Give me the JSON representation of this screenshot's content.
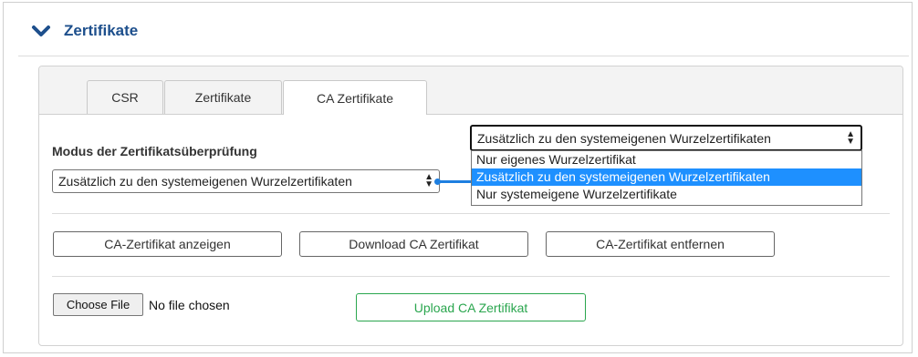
{
  "section": {
    "title": "Zertifikate",
    "color": "#1d4f8c"
  },
  "tabs": [
    {
      "label": "CSR",
      "active": false
    },
    {
      "label": "Zertifikate",
      "active": false
    },
    {
      "label": "CA Zertifikate",
      "active": true
    }
  ],
  "mode": {
    "label": "Modus der Zertifikatsüberprüfung",
    "selected_value": "Zusätzlich zu den systemeigenen Wurzelzertifikaten",
    "options": [
      "Nur eigenes Wurzelzertifikat",
      "Zusätzlich zu den systemeigenen Wurzelzertifikaten",
      "Nur systemeigene Wurzelzertifikate"
    ],
    "highlighted_option": "Zusätzlich zu den systemeigenen Wurzelzertifikaten"
  },
  "actions": {
    "show_label": "CA-Zertifikat anzeigen",
    "download_label": "Download CA Zertifikat",
    "remove_label": "CA-Zertifikat entfernen"
  },
  "upload": {
    "choose_label": "Choose File",
    "file_status": "No file chosen",
    "upload_label": "Upload CA Zertifikat",
    "upload_color": "#2aa64e"
  },
  "colors": {
    "highlight": "#1e90ff",
    "connector": "#1e7fe0"
  }
}
